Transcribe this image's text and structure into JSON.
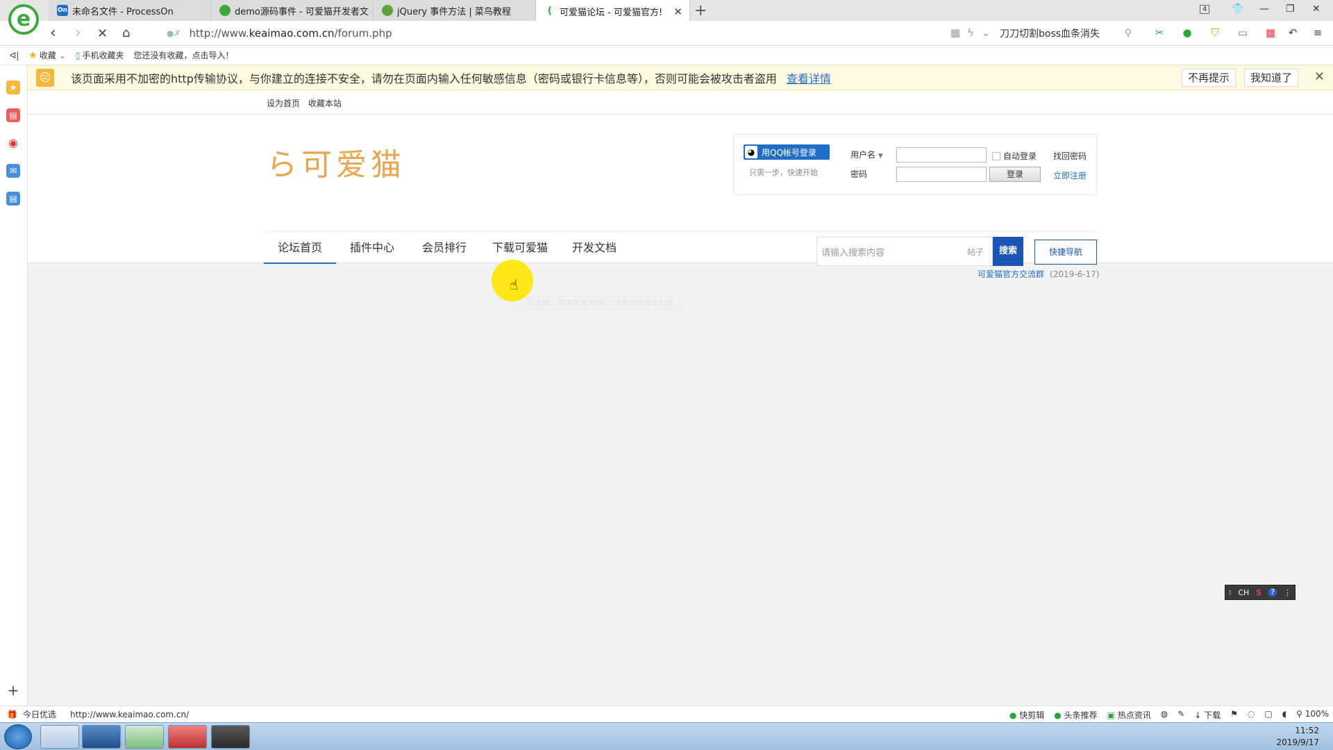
{
  "browser": {
    "tabs": [
      {
        "label": "未命名文件 - ProcessOn",
        "favicon": "On",
        "color": "#1f6fc6"
      },
      {
        "label": "demo源码事件 - 可爱猫开发者文",
        "favicon": "",
        "color": "#3da93d"
      },
      {
        "label": "jQuery 事件方法 | 菜鸟教程",
        "favicon": "",
        "color": "#5fa33c"
      },
      {
        "label": "可爱猫论坛 - 可爱猫官方!",
        "favicon": "",
        "color": "#e8a552"
      }
    ],
    "tab_count": "4",
    "url_prefix": "http://www.",
    "url_domain": "keaimao.com.cn",
    "url_path": "/forum.php",
    "search_text": "刀刀切割boss血条消失"
  },
  "bookmarks": {
    "favorites_label": "收藏",
    "mobile_label": "手机收藏夹",
    "import_hint": "您还没有收藏，点击导入！"
  },
  "warning": {
    "text": "该页面采用不加密的http传输协议，与你建立的连接不安全，请勿在页面内输入任何敏感信息（密码或银行卡信息等），否则可能会被攻击者盗用",
    "link": "查看详情",
    "btn_no_remind": "不再提示",
    "btn_ok": "我知道了"
  },
  "site": {
    "top_links": [
      "设为首页",
      "收藏本站"
    ],
    "logo_text": "可爱猫",
    "login": {
      "qq_button": "用QQ帐号登录",
      "qq_hint": "只需一步，快速开始",
      "username_label": "用户名",
      "password_label": "密码",
      "auto_login": "自动登录",
      "find_password": "找回密码",
      "login_button": "登录",
      "register": "立即注册"
    },
    "nav": [
      "论坛首页",
      "插件中心",
      "会员排行",
      "下载可爱猫",
      "开发文档"
    ],
    "search": {
      "placeholder": "请输入搜索内容",
      "category": "帖子",
      "button": "搜索",
      "quick_nav": "快捷导航"
    },
    "notice": {
      "text": "可爱猫官方交流群",
      "date": "(2019-6-17)"
    },
    "faded_notice": "可爱猫：新本发布  问题交流及应用分享社区"
  },
  "ime": {
    "lang": "CH"
  },
  "statusbar": {
    "left_label": "今日优选",
    "url": "http://www.keaimao.com.cn/",
    "right_items": [
      "快剪辑",
      "头条推荐",
      "热点资讯",
      "下载",
      "100%"
    ]
  },
  "taskbar": {
    "time": "11:52",
    "date": "2019/9/17"
  }
}
